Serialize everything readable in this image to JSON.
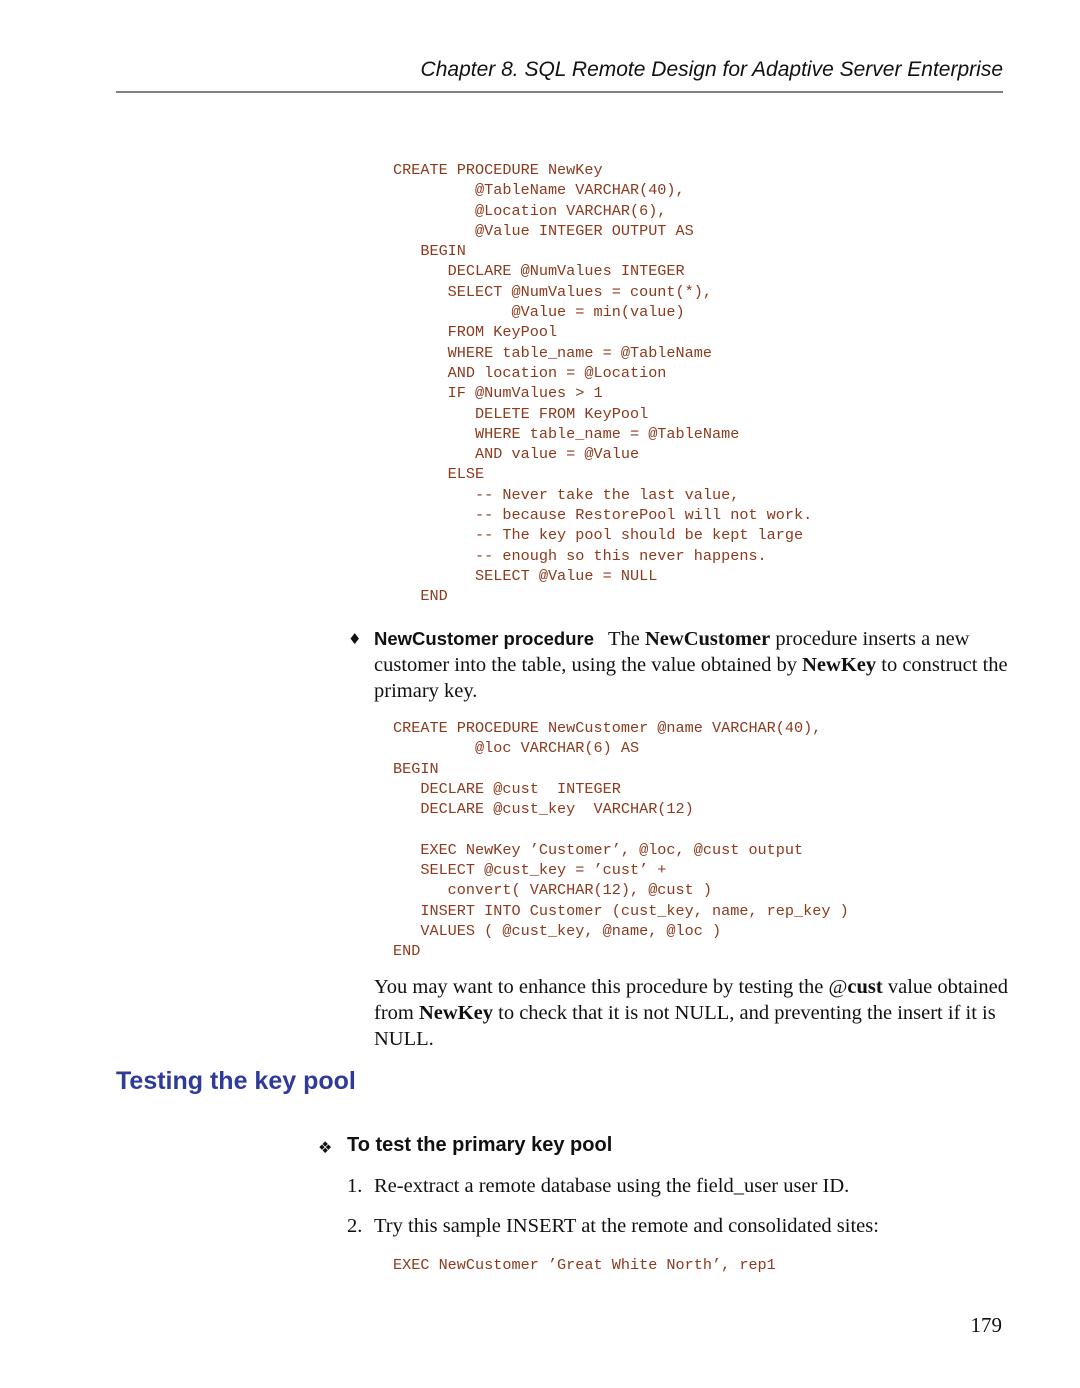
{
  "header": {
    "chapter_title": "Chapter 8.  SQL Remote Design for Adaptive Server Enterprise"
  },
  "code_newkey": {
    "lines": [
      "CREATE PROCEDURE NewKey",
      "         @TableName VARCHAR(40),",
      "         @Location VARCHAR(6),",
      "         @Value INTEGER OUTPUT AS",
      "   BEGIN",
      "      DECLARE @NumValues INTEGER",
      "      SELECT @NumValues = count(*),",
      "             @Value = min(value)",
      "      FROM KeyPool",
      "      WHERE table_name = @TableName",
      "      AND location = @Location",
      "      IF @NumValues > 1",
      "         DELETE FROM KeyPool",
      "         WHERE table_name = @TableName",
      "         AND value = @Value",
      "      ELSE",
      "         -- Never take the last value,",
      "         -- because RestorePool will not work.",
      "         -- The key pool should be kept large",
      "         -- enough so this never happens.",
      "         SELECT @Value = NULL",
      "   END"
    ]
  },
  "newcustomer_bullet": {
    "bullet_glyph": "♦",
    "run_in_heading": "NewCustomer procedure",
    "text_1": "The ",
    "bold_1": "NewCustomer",
    "text_2": " procedure inserts a new customer into the table, using the value obtained by ",
    "bold_2": "NewKey",
    "text_3": " to construct the primary key."
  },
  "code_newcustomer": {
    "lines": [
      "CREATE PROCEDURE NewCustomer @name VARCHAR(40),",
      "         @loc VARCHAR(6) AS",
      "BEGIN",
      "   DECLARE @cust  INTEGER",
      "   DECLARE @cust_key  VARCHAR(12)",
      "",
      "   EXEC NewKey ’Customer’, @loc, @cust output",
      "   SELECT @cust_key = ’cust’ +",
      "      convert( VARCHAR(12), @cust )",
      "   INSERT INTO Customer (cust_key, name, rep_key )",
      "   VALUES ( @cust_key, @name, @loc )",
      "END"
    ]
  },
  "note": {
    "text_1": "You may want to enhance this procedure by testing the ",
    "at_sign": "@",
    "bold_1": "cust",
    "text_2": " value obtained from ",
    "bold_2": "NewKey",
    "text_3": " to check that it is not NULL, and preventing the insert if it is NULL."
  },
  "section": {
    "heading": "Testing the key pool"
  },
  "procedure": {
    "glyph": "❖",
    "heading": "To test the primary key pool",
    "steps": [
      {
        "number": "1.",
        "text": "Re-extract a remote database using the field_user user ID."
      },
      {
        "number": "2.",
        "text": "Try this sample INSERT at the remote and consolidated sites:"
      }
    ],
    "code": "EXEC NewCustomer ’Great White North’, rep1"
  },
  "footer": {
    "page_number": "179"
  }
}
